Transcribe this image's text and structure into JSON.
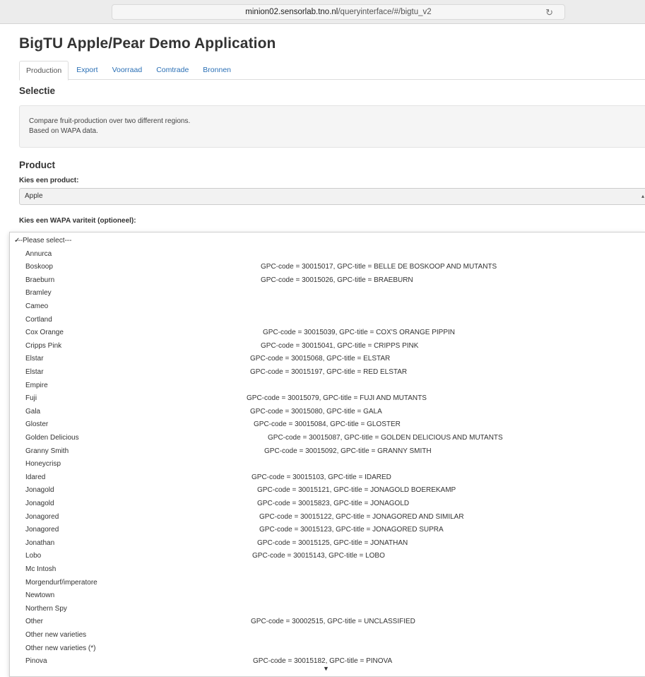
{
  "browser": {
    "url_host": "minion02.sensorlab.tno.nl",
    "url_path": "/queryinterface/#/bigtu_v2"
  },
  "app": {
    "title": "BigTU Apple/Pear Demo Application"
  },
  "tabs": [
    {
      "label": "Production",
      "active": true
    },
    {
      "label": "Export",
      "active": false
    },
    {
      "label": "Voorraad",
      "active": false
    },
    {
      "label": "Comtrade",
      "active": false
    },
    {
      "label": "Bronnen",
      "active": false
    }
  ],
  "selectie": {
    "heading": "Selectie",
    "description_line1": "Compare fruit-production over two different regions.",
    "description_line2": "Based on WAPA data."
  },
  "product": {
    "heading": "Product",
    "product_label": "Kies een product:",
    "product_value": "Apple",
    "variety_label": "Kies een WAPA variteit (optioneel):"
  },
  "variety_options": [
    {
      "name": "---Please select---",
      "gpc": "",
      "selected": true
    },
    {
      "name": "Annurca",
      "gpc": ""
    },
    {
      "name": "Boskoop",
      "gpc": "GPC-code = 30015017, GPC-title = BELLE DE BOSKOOP AND MUTANTS"
    },
    {
      "name": "Braeburn",
      "gpc": "GPC-code = 30015026, GPC-title = BRAEBURN"
    },
    {
      "name": "Bramley",
      "gpc": ""
    },
    {
      "name": "Cameo",
      "gpc": ""
    },
    {
      "name": "Cortland",
      "gpc": ""
    },
    {
      "name": "Cox Orange",
      "gpc": "GPC-code = 30015039, GPC-title = COX'S ORANGE PIPPIN"
    },
    {
      "name": "Cripps Pink",
      "gpc": "GPC-code = 30015041, GPC-title = CRIPPS PINK"
    },
    {
      "name": "Elstar",
      "gpc": "GPC-code = 30015068, GPC-title = ELSTAR"
    },
    {
      "name": "Elstar",
      "gpc": "GPC-code = 30015197, GPC-title = RED ELSTAR"
    },
    {
      "name": "Empire",
      "gpc": ""
    },
    {
      "name": "Fuji",
      "gpc": "GPC-code = 30015079, GPC-title = FUJI AND MUTANTS"
    },
    {
      "name": "Gala",
      "gpc": "GPC-code = 30015080, GPC-title = GALA"
    },
    {
      "name": "Gloster",
      "gpc": "GPC-code = 30015084, GPC-title = GLOSTER"
    },
    {
      "name": "Golden Delicious",
      "gpc": "GPC-code = 30015087, GPC-title = GOLDEN DELICIOUS AND MUTANTS"
    },
    {
      "name": "Granny Smith",
      "gpc": "GPC-code = 30015092, GPC-title = GRANNY SMITH"
    },
    {
      "name": "Honeycrisp",
      "gpc": ""
    },
    {
      "name": "Idared",
      "gpc": "GPC-code = 30015103, GPC-title = IDARED"
    },
    {
      "name": "Jonagold",
      "gpc": "GPC-code = 30015121, GPC-title = JONAGOLD BOEREKAMP"
    },
    {
      "name": "Jonagold",
      "gpc": "GPC-code = 30015823, GPC-title = JONAGOLD"
    },
    {
      "name": "Jonagored",
      "gpc": "GPC-code = 30015122, GPC-title = JONAGORED AND SIMILAR"
    },
    {
      "name": "Jonagored",
      "gpc": "GPC-code = 30015123, GPC-title = JONAGORED SUPRA"
    },
    {
      "name": "Jonathan",
      "gpc": "GPC-code = 30015125, GPC-title = JONATHAN"
    },
    {
      "name": "Lobo",
      "gpc": "GPC-code = 30015143, GPC-title = LOBO"
    },
    {
      "name": "Mc Intosh",
      "gpc": ""
    },
    {
      "name": "Morgendurf/imperatore",
      "gpc": ""
    },
    {
      "name": "Newtown",
      "gpc": ""
    },
    {
      "name": "Northern Spy",
      "gpc": ""
    },
    {
      "name": "Other",
      "gpc": "GPC-code = 30002515, GPC-title = UNCLASSIFIED"
    },
    {
      "name": "Other new varieties",
      "gpc": ""
    },
    {
      "name": "Other new varieties (*)",
      "gpc": ""
    },
    {
      "name": "Pinova",
      "gpc": "GPC-code = 30015182, GPC-title = PINOVA"
    }
  ]
}
